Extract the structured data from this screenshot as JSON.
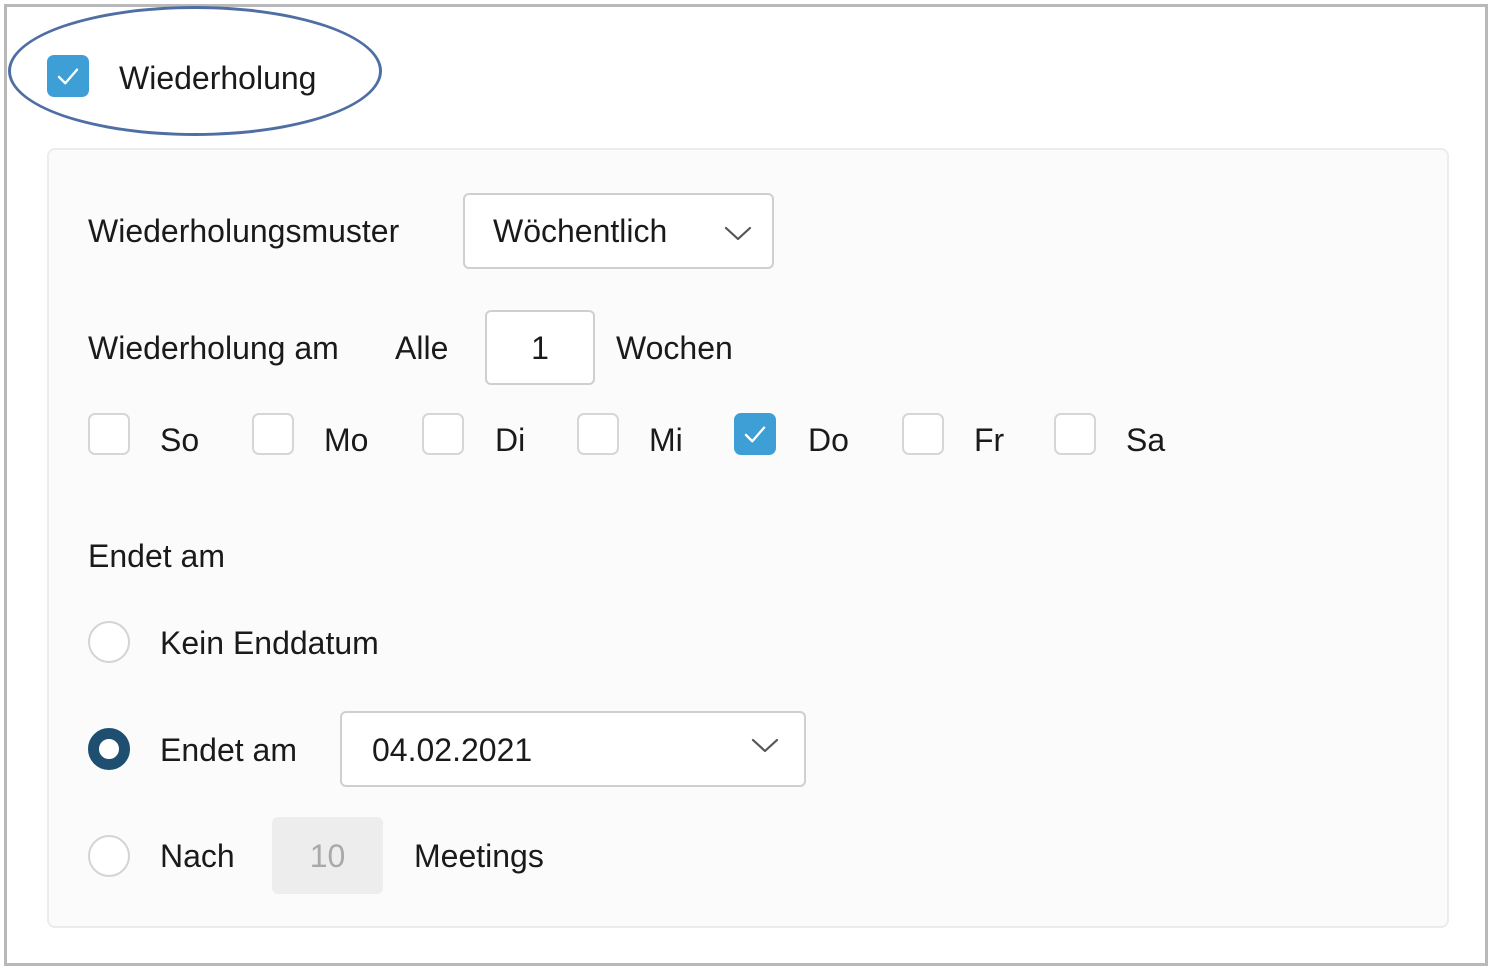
{
  "repeat": {
    "label": "Wiederholung",
    "checked": true
  },
  "pattern": {
    "label": "Wiederholungsmuster",
    "selected": "Wöchentlich"
  },
  "interval": {
    "label": "Wiederholung am",
    "prefix": "Alle",
    "value": "1",
    "suffix": "Wochen"
  },
  "days": [
    {
      "label": "So",
      "checked": false
    },
    {
      "label": "Mo",
      "checked": false
    },
    {
      "label": "Di",
      "checked": false
    },
    {
      "label": "Mi",
      "checked": false
    },
    {
      "label": "Do",
      "checked": true
    },
    {
      "label": "Fr",
      "checked": false
    },
    {
      "label": "Sa",
      "checked": false
    }
  ],
  "end": {
    "title": "Endet am",
    "options": [
      {
        "label": "Kein Enddatum",
        "selected": false
      },
      {
        "label": "Endet am",
        "selected": true,
        "date": "04.02.2021"
      },
      {
        "label": "Nach",
        "selected": false,
        "count": "10",
        "suffix": "Meetings"
      }
    ]
  },
  "colors": {
    "accent": "#3e9fd6",
    "radio_selected": "#1f4f70",
    "highlight_oval": "#4f6fa4"
  }
}
